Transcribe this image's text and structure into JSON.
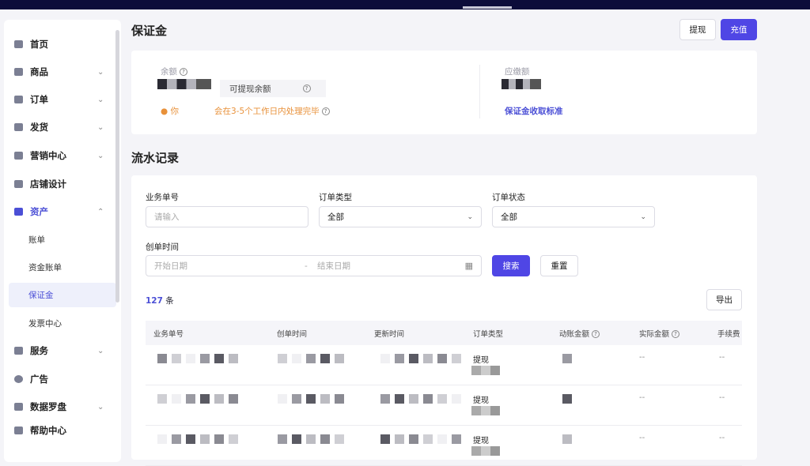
{
  "sidebar": {
    "items": [
      {
        "label": "首页",
        "chevron": false
      },
      {
        "label": "商品",
        "chevron": true
      },
      {
        "label": "订单",
        "chevron": true
      },
      {
        "label": "发货",
        "chevron": true
      },
      {
        "label": "营销中心",
        "chevron": true
      },
      {
        "label": "店铺设计",
        "chevron": false
      },
      {
        "label": "资产",
        "chevron": true,
        "active": true
      }
    ],
    "sub_items": [
      "账单",
      "资金账单",
      "保证金",
      "发票中心"
    ],
    "items2": [
      {
        "label": "服务",
        "chevron": true
      },
      {
        "label": "广告",
        "chevron": false
      },
      {
        "label": "数据罗盘",
        "chevron": true
      },
      {
        "label": "帮助中心",
        "chevron": false
      }
    ]
  },
  "header": {
    "title": "保证金",
    "withdraw": "提现",
    "recharge": "充值"
  },
  "balance": {
    "label": "余额",
    "withdrawable_label": "可提现余额",
    "notice_prefix": "你",
    "notice_suffix": "会在3-5个工作日内处理完毕",
    "payable_label": "应缴额",
    "standard_link": "保证金收取标准"
  },
  "records": {
    "title": "流水记录",
    "filters": {
      "order_no_label": "业务单号",
      "order_no_placeholder": "请输入",
      "order_type_label": "订单类型",
      "order_type_value": "全部",
      "order_status_label": "订单状态",
      "order_status_value": "全部",
      "created_label": "创单时间",
      "start_placeholder": "开始日期",
      "separator": "-",
      "end_placeholder": "结束日期",
      "search": "搜索",
      "reset": "重置"
    },
    "count": "127",
    "count_unit": "条",
    "export": "导出",
    "columns": [
      "业务单号",
      "创单时间",
      "更新时间",
      "订单类型",
      "动账金额",
      "实际金额",
      "手续费"
    ],
    "rows": [
      {
        "type": "提现",
        "actual": "--",
        "fee": "--"
      },
      {
        "type": "提现",
        "actual": "--",
        "fee": "--"
      },
      {
        "type": "提现",
        "actual": "--",
        "fee": "--"
      }
    ]
  },
  "colors": {
    "primary": "#4f46e5",
    "warning": "#e8913a",
    "topbar": "#0c0c3a"
  }
}
